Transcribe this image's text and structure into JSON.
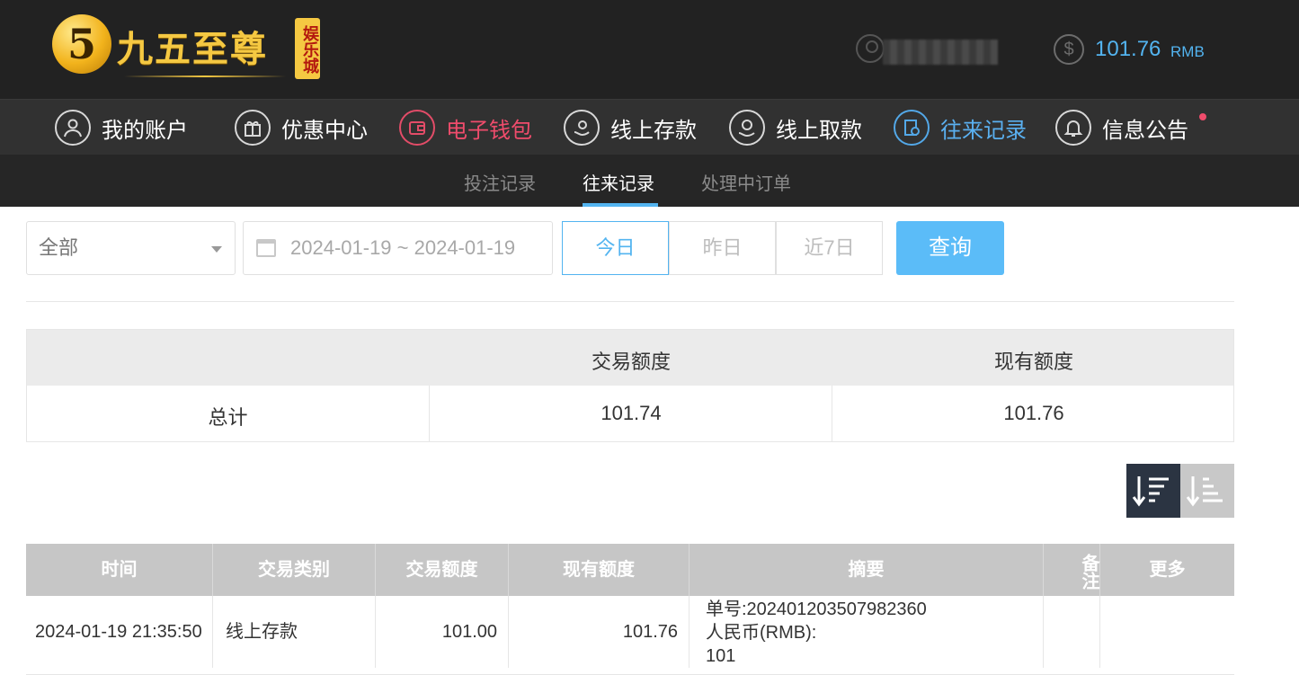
{
  "header": {
    "logo_mark": "5",
    "logo_title": "九五至尊",
    "logo_badge": "娱乐城",
    "balance_amount": "101.76",
    "balance_unit": "RMB"
  },
  "nav": {
    "items": [
      {
        "label": "我的账户",
        "icon": "user-icon"
      },
      {
        "label": "优惠中心",
        "icon": "gift-icon"
      },
      {
        "label": "电子钱包",
        "icon": "wallet-icon"
      },
      {
        "label": "线上存款",
        "icon": "deposit-icon"
      },
      {
        "label": "线上取款",
        "icon": "withdraw-icon"
      },
      {
        "label": "往来记录",
        "icon": "records-icon"
      },
      {
        "label": "信息公告",
        "icon": "bell-icon"
      }
    ],
    "active_index": 5,
    "highlight_index": 2
  },
  "subnav": {
    "items": [
      "投注记录",
      "往来记录",
      "处理中订单"
    ],
    "active_index": 1
  },
  "filter": {
    "type_selected": "全部",
    "date_range": "2024-01-19 ~ 2024-01-19",
    "quick_buttons": [
      "今日",
      "昨日",
      "近7日"
    ],
    "active_quick": 0,
    "query_label": "查询"
  },
  "summary": {
    "headers": [
      "",
      "交易额度",
      "现有额度"
    ],
    "row_label": "总计",
    "transaction_total": "101.74",
    "current_total": "101.76"
  },
  "records": {
    "headers": [
      "时间",
      "交易类别",
      "交易额度",
      "现有额度",
      "摘要",
      "备注",
      "更多"
    ],
    "rows": [
      {
        "time": "2024-01-19 21:35:50",
        "type": "线上存款",
        "amount": "101.00",
        "balance": "101.76",
        "summary_order": "单号:20240120350798236​0",
        "summary_currency": "人民币(RMB):",
        "summary_value": "101",
        "note": "",
        "more": ""
      }
    ]
  },
  "colors": {
    "accent_blue": "#53b4f0",
    "accent_red": "#f04c6c",
    "header_bg": "#222222",
    "logo_gold": "#f5c842"
  }
}
